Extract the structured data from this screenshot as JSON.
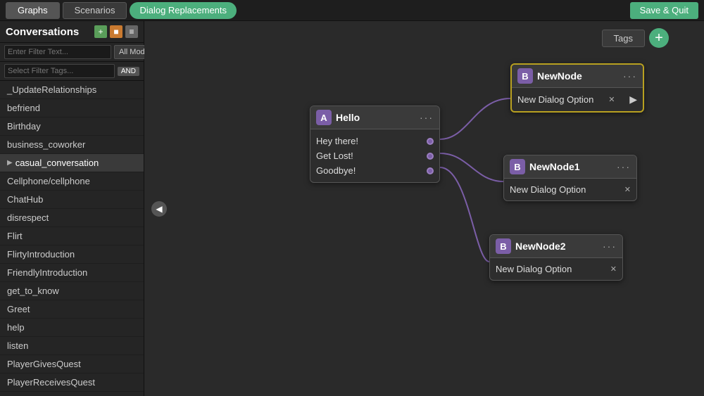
{
  "topbar": {
    "tabs": [
      {
        "label": "Graphs",
        "active": true
      },
      {
        "label": "Scenarios",
        "active": false
      }
    ],
    "dialog_replacements": "Dialog Replacements",
    "save_quit": "Save & Quit"
  },
  "sidebar": {
    "title": "Conversations",
    "filter_placeholder": "Enter Filter Text...",
    "filter_mod": "All Mods",
    "tags_placeholder": "Select Filter Tags...",
    "and_label": "AND",
    "items": [
      {
        "label": "_UpdateRelationships",
        "selected": false
      },
      {
        "label": "befriend",
        "selected": false
      },
      {
        "label": "Birthday",
        "selected": false
      },
      {
        "label": "business_coworker",
        "selected": false
      },
      {
        "label": "casual_conversation",
        "selected": true
      },
      {
        "label": "Cellphone/cellphone",
        "selected": false
      },
      {
        "label": "ChatHub",
        "selected": false
      },
      {
        "label": "disrespect",
        "selected": false
      },
      {
        "label": "Flirt",
        "selected": false
      },
      {
        "label": "FlirtyIntroduction",
        "selected": false
      },
      {
        "label": "FriendlyIntroduction",
        "selected": false
      },
      {
        "label": "get_to_know",
        "selected": false
      },
      {
        "label": "Greet",
        "selected": false
      },
      {
        "label": "help",
        "selected": false
      },
      {
        "label": "listen",
        "selected": false
      },
      {
        "label": "PlayerGivesQuest",
        "selected": false
      },
      {
        "label": "PlayerReceivesQuest",
        "selected": false
      }
    ]
  },
  "canvas": {
    "tags_button": "Tags",
    "node_a": {
      "letter": "A",
      "title": "Hello",
      "options": [
        "Hey there!",
        "Get Lost!",
        "Goodbye!"
      ]
    },
    "nodes_b": [
      {
        "id": "NewNode",
        "letter": "B",
        "title": "NewNode",
        "option": "New Dialog Option",
        "highlighted": true
      },
      {
        "id": "NewNode1",
        "letter": "B",
        "title": "NewNode1",
        "option": "New Dialog Option",
        "highlighted": false
      },
      {
        "id": "NewNode2",
        "letter": "B",
        "title": "NewNode2",
        "option": "New Dialog Option",
        "highlighted": false
      }
    ]
  }
}
